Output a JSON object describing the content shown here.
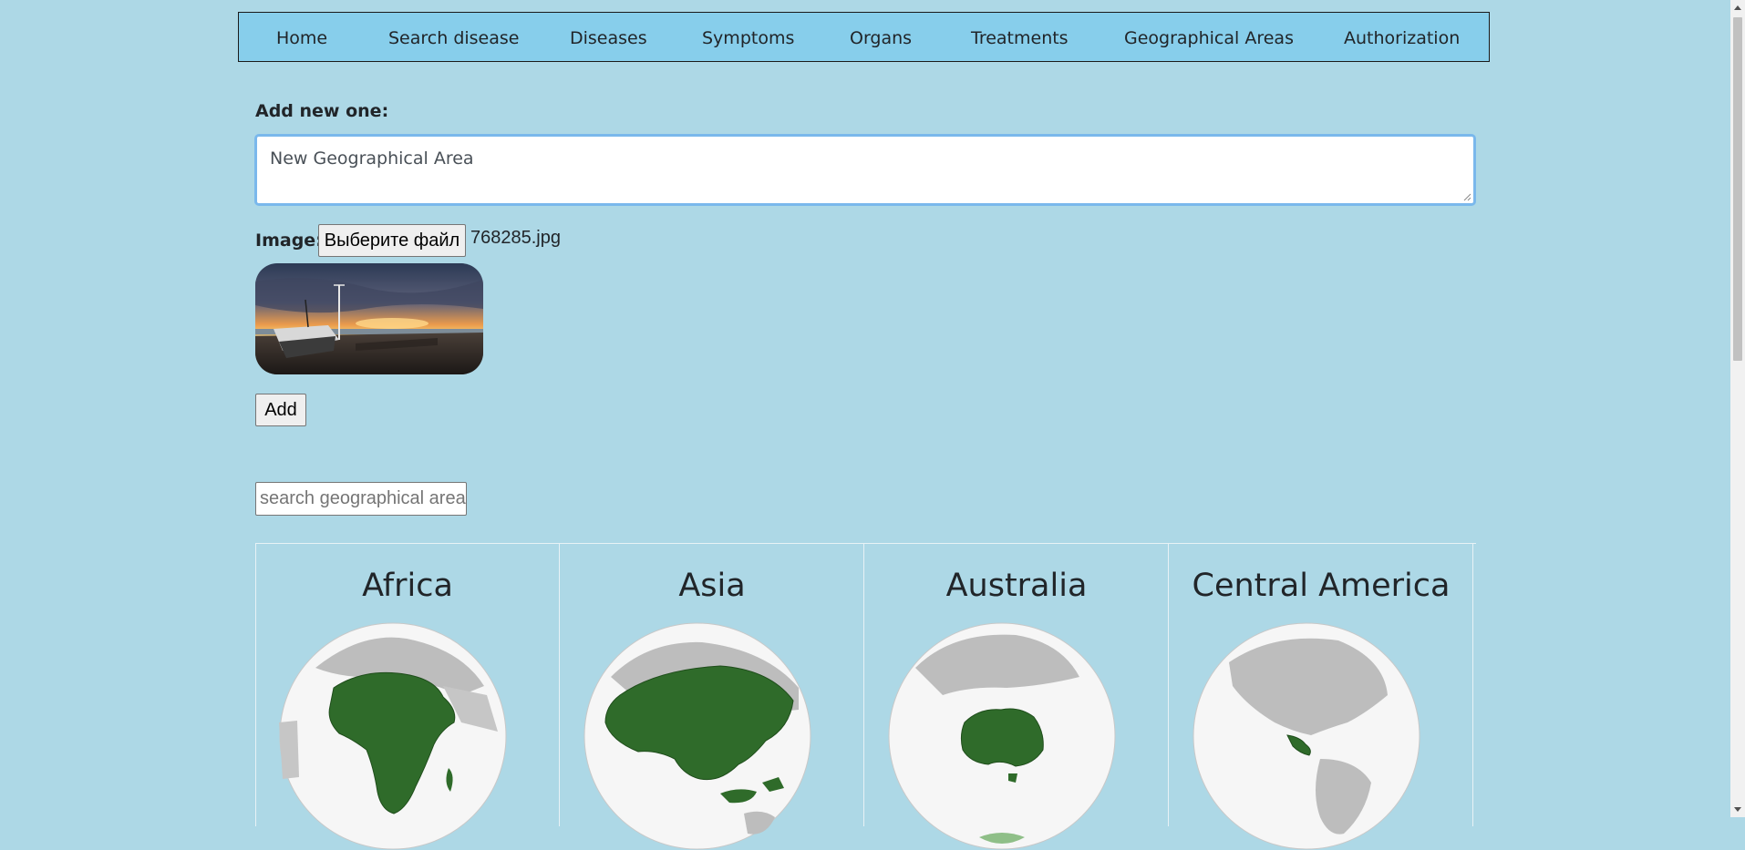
{
  "nav": {
    "items": [
      {
        "label": "Home"
      },
      {
        "label": "Search disease"
      },
      {
        "label": "Diseases"
      },
      {
        "label": "Symptoms"
      },
      {
        "label": "Organs"
      },
      {
        "label": "Treatments"
      },
      {
        "label": "Geographical Areas"
      },
      {
        "label": "Authorization"
      }
    ]
  },
  "form": {
    "add_label": "Add new one:",
    "name_value": "New Geographical Area",
    "image_label": "Image:",
    "file_button": "Выберите файл",
    "file_name": "768285.jpg",
    "add_button": "Add"
  },
  "search": {
    "placeholder": "search geographical area"
  },
  "areas": [
    {
      "name": "Africa"
    },
    {
      "name": "Asia"
    },
    {
      "name": "Australia"
    },
    {
      "name": "Central America"
    }
  ],
  "colors": {
    "background": "#add8e6",
    "nav_background": "#87ceeb",
    "highlight": "#2f6b2a"
  }
}
